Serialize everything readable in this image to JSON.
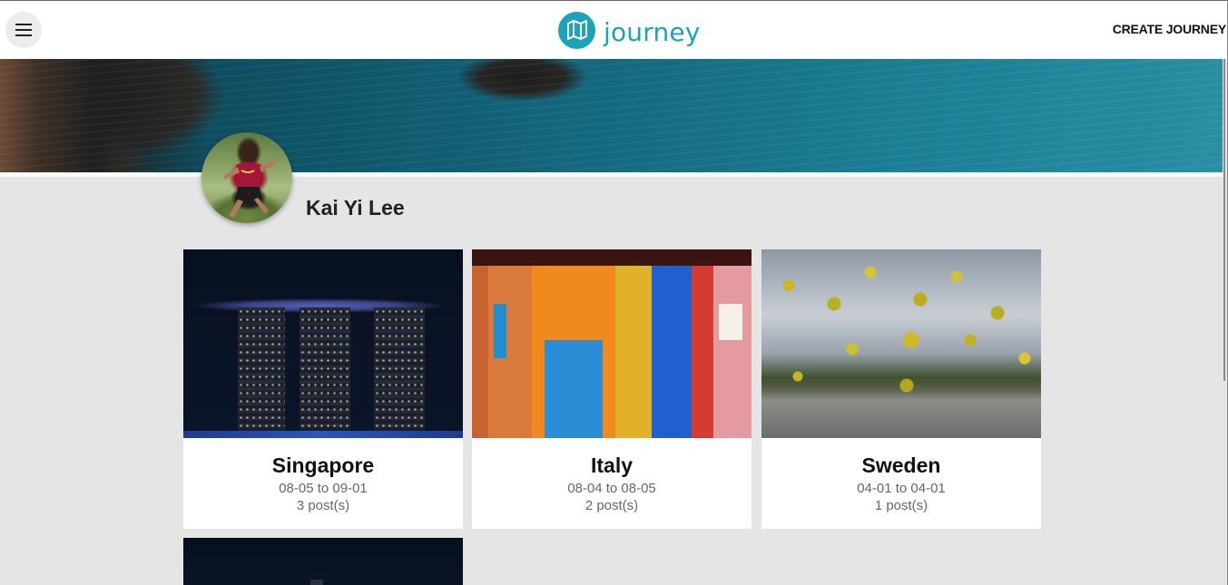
{
  "header": {
    "brand_name": "journey",
    "create_label": "CREATE JOURNEY",
    "menu_icon": "hamburger-menu-icon",
    "logo_icon": "map-icon",
    "brand_color": "#1aa3b9"
  },
  "profile": {
    "name": "Kai Yi Lee"
  },
  "journeys": [
    {
      "title": "Singapore",
      "dates": "08-05 to 09-01",
      "posts": "3 post(s)"
    },
    {
      "title": "Italy",
      "dates": "08-04 to 08-05",
      "posts": "2 post(s)"
    },
    {
      "title": "Sweden",
      "dates": "04-01 to 04-01",
      "posts": "1 post(s)"
    }
  ]
}
